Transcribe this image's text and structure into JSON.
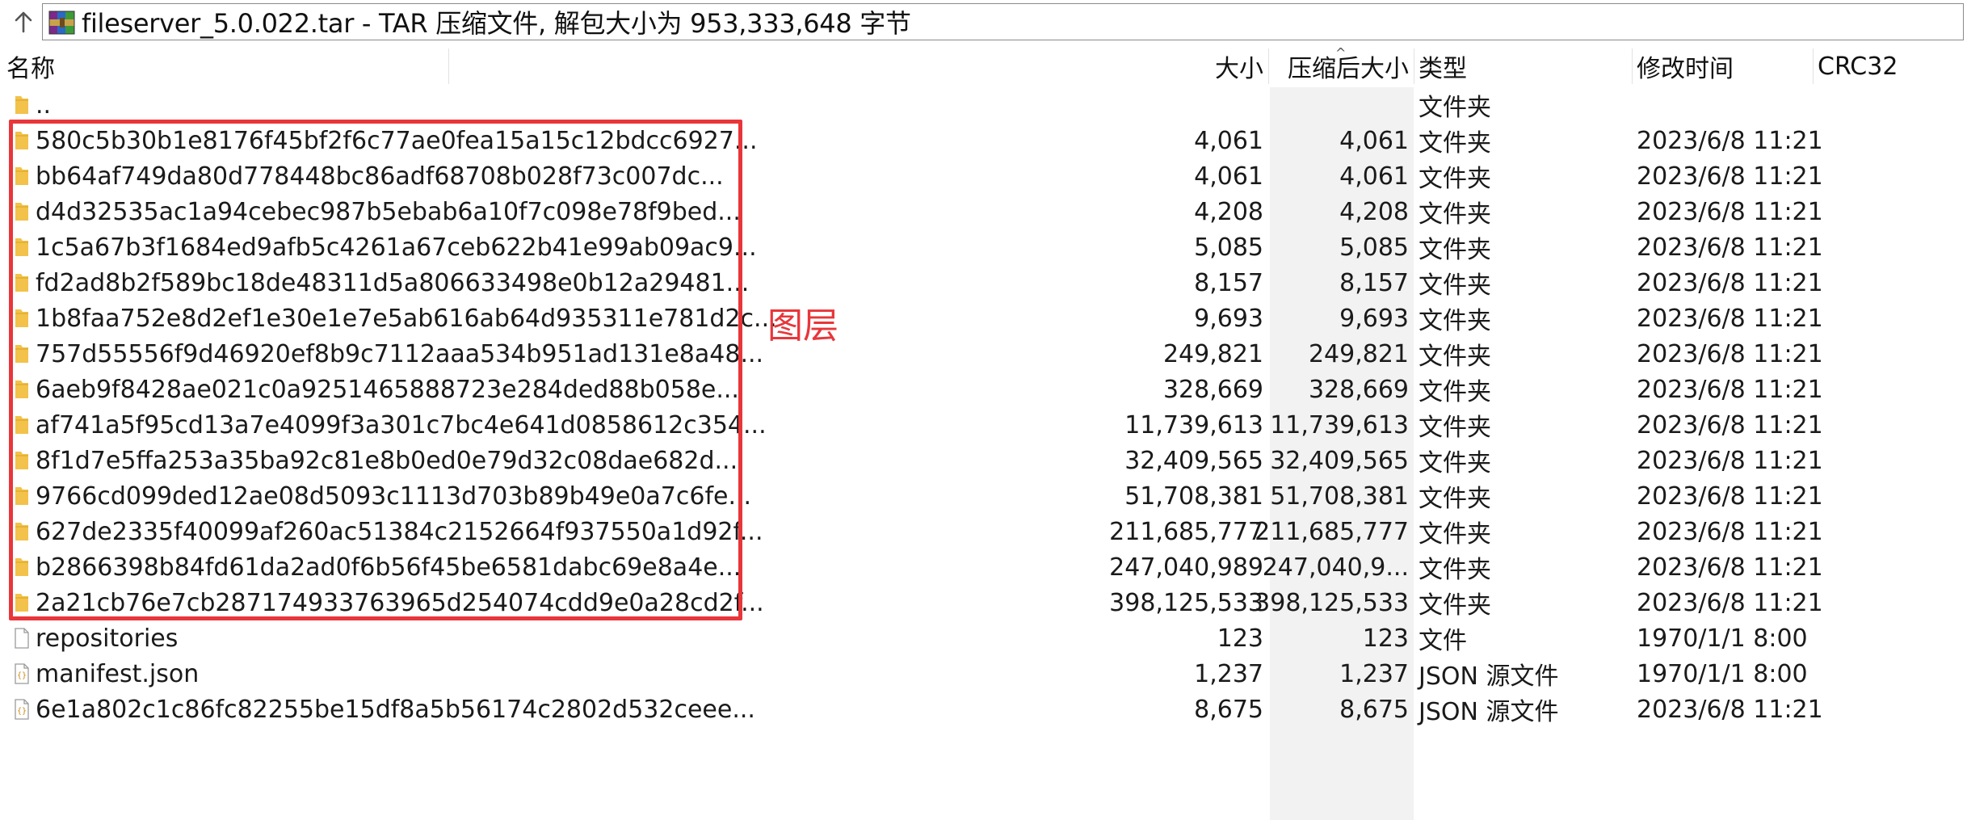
{
  "pathbar": {
    "path_text": "fileserver_5.0.022.tar - TAR 压缩文件, 解包大小为 953,333,648 字节"
  },
  "columns": {
    "name": "名称",
    "size": "大小",
    "packed": "压缩后大小",
    "type": "类型",
    "modified": "修改时间",
    "crc": "CRC32"
  },
  "rows": [
    {
      "icon": "folder-icon",
      "name": "..",
      "size": "",
      "packed": "",
      "type": "文件夹",
      "modified": ""
    },
    {
      "icon": "folder-icon",
      "name": "580c5b30b1e8176f45bf2f6c77ae0fea15a15c12bdcc6927...",
      "size": "4,061",
      "packed": "4,061",
      "type": "文件夹",
      "modified": "2023/6/8 11:21"
    },
    {
      "icon": "folder-icon",
      "name": "bb64af749da80d778448bc86adf68708b028f73c007dc...",
      "size": "4,061",
      "packed": "4,061",
      "type": "文件夹",
      "modified": "2023/6/8 11:21"
    },
    {
      "icon": "folder-icon",
      "name": "d4d32535ac1a94cebec987b5ebab6a10f7c098e78f9bed...",
      "size": "4,208",
      "packed": "4,208",
      "type": "文件夹",
      "modified": "2023/6/8 11:21"
    },
    {
      "icon": "folder-icon",
      "name": "1c5a67b3f1684ed9afb5c4261a67ceb622b41e99ab09ac9...",
      "size": "5,085",
      "packed": "5,085",
      "type": "文件夹",
      "modified": "2023/6/8 11:21"
    },
    {
      "icon": "folder-icon",
      "name": "fd2ad8b2f589bc18de48311d5a806633498e0b12a29481...",
      "size": "8,157",
      "packed": "8,157",
      "type": "文件夹",
      "modified": "2023/6/8 11:21"
    },
    {
      "icon": "folder-icon",
      "name": "1b8faa752e8d2ef1e30e1e7e5ab616ab64d935311e781d2c...",
      "size": "9,693",
      "packed": "9,693",
      "type": "文件夹",
      "modified": "2023/6/8 11:21"
    },
    {
      "icon": "folder-icon",
      "name": "757d55556f9d46920ef8b9c7112aaa534b951ad131e8a48...",
      "size": "249,821",
      "packed": "249,821",
      "type": "文件夹",
      "modified": "2023/6/8 11:21"
    },
    {
      "icon": "folder-icon",
      "name": "6aeb9f8428ae021c0a9251465888723e284ded88b058e...",
      "size": "328,669",
      "packed": "328,669",
      "type": "文件夹",
      "modified": "2023/6/8 11:21"
    },
    {
      "icon": "folder-icon",
      "name": "af741a5f95cd13a7e4099f3a301c7bc4e641d0858612c354...",
      "size": "11,739,613",
      "packed": "11,739,613",
      "type": "文件夹",
      "modified": "2023/6/8 11:21"
    },
    {
      "icon": "folder-icon",
      "name": "8f1d7e5ffa253a35ba92c81e8b0ed0e79d32c08dae682d...",
      "size": "32,409,565",
      "packed": "32,409,565",
      "type": "文件夹",
      "modified": "2023/6/8 11:21"
    },
    {
      "icon": "folder-icon",
      "name": "9766cd099ded12ae08d5093c1113d703b89b49e0a7c6fe...",
      "size": "51,708,381",
      "packed": "51,708,381",
      "type": "文件夹",
      "modified": "2023/6/8 11:21"
    },
    {
      "icon": "folder-icon",
      "name": "627de2335f40099af260ac51384c2152664f937550a1d92f...",
      "size": "211,685,777",
      "packed": "211,685,777",
      "type": "文件夹",
      "modified": "2023/6/8 11:21"
    },
    {
      "icon": "folder-icon",
      "name": "b2866398b84fd61da2ad0f6b56f45be6581dabc69e8a4e...",
      "size": "247,040,989",
      "packed": "247,040,9...",
      "type": "文件夹",
      "modified": "2023/6/8 11:21"
    },
    {
      "icon": "folder-icon",
      "name": "2a21cb76e7cb287174933763965d254074cdd9e0a28cd2f...",
      "size": "398,125,533",
      "packed": "398,125,533",
      "type": "文件夹",
      "modified": "2023/6/8 11:21"
    },
    {
      "icon": "file-icon",
      "name": "repositories",
      "size": "123",
      "packed": "123",
      "type": "文件",
      "modified": "1970/1/1 8:00"
    },
    {
      "icon": "json-file-icon",
      "name": "manifest.json",
      "size": "1,237",
      "packed": "1,237",
      "type": "JSON 源文件",
      "modified": "1970/1/1 8:00"
    },
    {
      "icon": "json-file-icon",
      "name": "6e1a802c1c86fc82255be15df8a5b56174c2802d532ceee...",
      "size": "8,675",
      "packed": "8,675",
      "type": "JSON 源文件",
      "modified": "2023/6/8 11:21"
    }
  ],
  "annotation": {
    "label": "图层",
    "color": "#e8363a"
  },
  "colors": {
    "folder": "#f2c24a",
    "accent_red": "#e8363a",
    "sort_column_bg": "#f2f2f2"
  }
}
